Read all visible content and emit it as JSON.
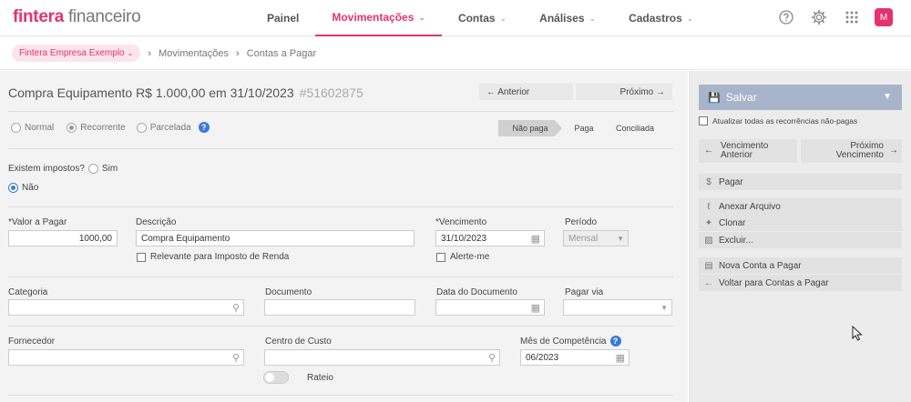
{
  "brand": {
    "bold": "fintera",
    "light": "financeiro"
  },
  "nav": [
    {
      "label": "Painel",
      "dropdown": false,
      "active": false
    },
    {
      "label": "Movimentações",
      "dropdown": true,
      "active": true
    },
    {
      "label": "Contas",
      "dropdown": true,
      "active": false
    },
    {
      "label": "Análises",
      "dropdown": true,
      "active": false
    },
    {
      "label": "Cadastros",
      "dropdown": true,
      "active": false
    }
  ],
  "user": {
    "initial": "M"
  },
  "icons": {
    "help": "help-circle-icon",
    "settings": "gear-icon",
    "apps": "grid-icon"
  },
  "breadcrumb": {
    "company": "Fintera Empresa Exemplo",
    "items": [
      "Movimentações",
      "Contas a Pagar"
    ]
  },
  "form": {
    "title": "Compra Equipamento R$ 1.000,00 em 31/10/2023",
    "id": "#51602875",
    "prev_label": "← Anterior",
    "next_label": "Próximo →",
    "types": [
      "Normal",
      "Recorrente",
      "Parcelada"
    ],
    "selected_type": "Recorrente",
    "status_steps": [
      "Não paga",
      "Paga",
      "Conciliada"
    ],
    "current_status": "Não paga",
    "taxes_question": "Existem impostos?",
    "taxes_yes": "Sim",
    "taxes_no": "Não",
    "taxes_selected": "Não",
    "valor_label": "*Valor a Pagar",
    "valor_value": "1000,00",
    "descricao_label": "Descrição",
    "descricao_value": "Compra Equipamento",
    "relevante_label": "Relevante para Imposto de Renda",
    "vencimento_label": "*Vencimento",
    "vencimento_value": "31/10/2023",
    "alerte_label": "Alerte-me",
    "periodo_label": "Período",
    "periodo_value": "Mensal",
    "categoria_label": "Categoria",
    "documento_label": "Documento",
    "data_documento_label": "Data do Documento",
    "pagar_via_label": "Pagar via",
    "fornecedor_label": "Fornecedor",
    "centro_custo_label": "Centro de Custo",
    "rateio_label": "Rateio",
    "mes_competencia_label": "Mês de Competência",
    "mes_competencia_value": "06/2023"
  },
  "panel": {
    "save_label": "Salvar",
    "update_all_label": "Atualizar todas as recorrências não-pagas",
    "prev_due_line1": "Vencimento",
    "prev_due_line2": "Anterior",
    "next_due_line1": "Próximo",
    "next_due_line2": "Vencimento",
    "pay_label": "Pagar",
    "attach_label": "Anexar Arquivo",
    "clone_label": "Clonar",
    "delete_label": "Excluir...",
    "new_label": "Nova Conta a Pagar",
    "back_label": "Voltar para Contas a Pagar"
  },
  "colors": {
    "brand": "#e5326f",
    "accent_blue": "#3a79d8",
    "save_button": "#a8b4c9"
  }
}
